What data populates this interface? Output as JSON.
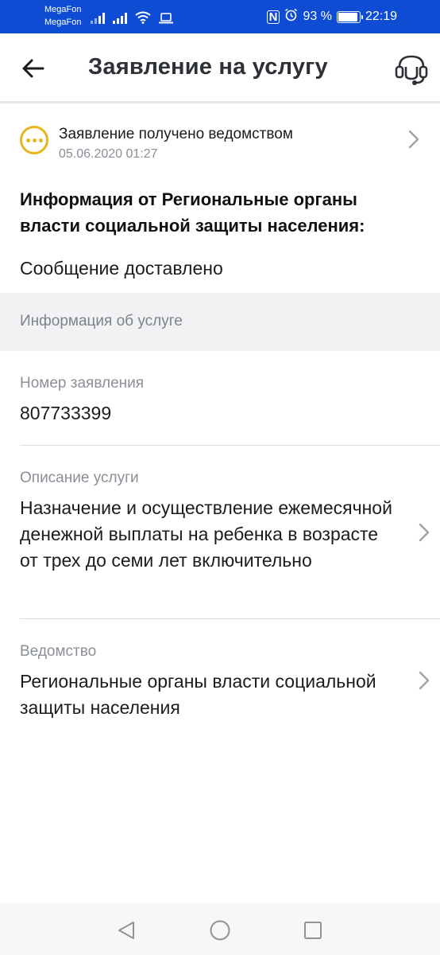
{
  "status_bar": {
    "carrier_1": "MegaFon",
    "carrier_2": "MegaFon",
    "nfc": "N",
    "battery": "93 %",
    "battery_level": 0.93,
    "time": "22:19"
  },
  "header": {
    "title": "Заявление на услугу",
    "back_icon": "arrow-left-icon",
    "support_icon": "headset-icon"
  },
  "status": {
    "title": "Заявление получено ведомством",
    "date": "05.06.2020 01:27",
    "icon": "three-dots-circle-icon",
    "icon_color": "#e9b420"
  },
  "info": {
    "heading": "Информация от Региональные органы власти социальной защиты населения:",
    "message": "Сообщение доставлено"
  },
  "service_section": {
    "title": "Информация об услуге",
    "fields": [
      {
        "label": "Номер заявления",
        "value": "807733399"
      },
      {
        "label": "Описание услуги",
        "value": "Назначение и осуществление ежемесячной денежной выплаты на ребенка в возрасте от трех до семи лет включительно"
      },
      {
        "label": "Ведомство",
        "value": "Региональные органы власти социальной защиты населения"
      }
    ]
  },
  "colors": {
    "status_bar": "#0d4cd3",
    "accent_warning": "#e9b420",
    "muted_text": "#8a8f98"
  }
}
